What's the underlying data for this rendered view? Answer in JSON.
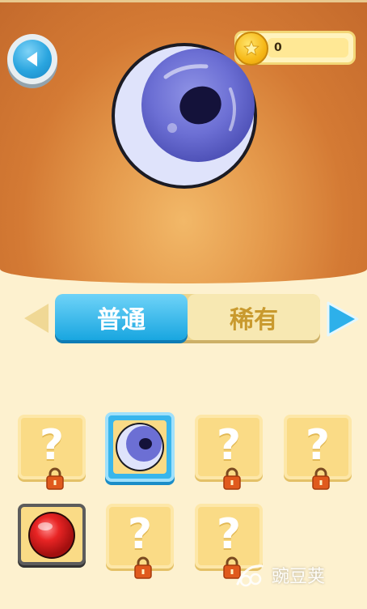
{
  "header": {
    "coins": "0"
  },
  "tabs": [
    {
      "label": "普通",
      "active": true
    },
    {
      "label": "稀有",
      "active": false
    }
  ],
  "grid": {
    "items": [
      {
        "state": "locked",
        "label": "?"
      },
      {
        "state": "selected",
        "ball": "purple-eye-ball"
      },
      {
        "state": "locked",
        "label": "?"
      },
      {
        "state": "locked",
        "label": "?"
      },
      {
        "state": "owned",
        "ball": "red-ball"
      },
      {
        "state": "locked",
        "label": "?"
      },
      {
        "state": "locked",
        "label": "?"
      }
    ]
  },
  "watermark": {
    "text": "豌豆荚"
  },
  "colors": {
    "accent_blue": "#19a6e0",
    "slot_yellow": "#fadb86",
    "background": "#fdf1cf"
  }
}
